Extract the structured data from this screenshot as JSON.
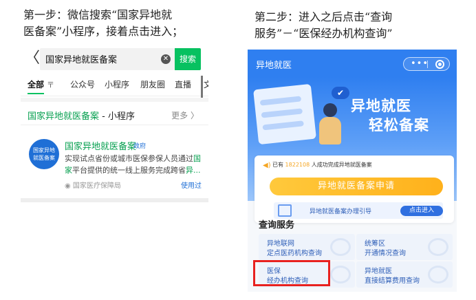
{
  "instructions": {
    "step1": "第一步：微信搜索“国家异地就\n医备案”小程序，接着点击进入；",
    "step2": "第二步：进入之后点击“查询\n服务”－“医保经办机构查询”"
  },
  "wechat_search": {
    "back_glyph": "〈",
    "query": "国家异地就医备案",
    "clear_glyph": "✕",
    "search_button": "搜索",
    "tabs": [
      "全部",
      "公众号",
      "小程序",
      "朋友圈",
      "直播",
      "文"
    ],
    "filter_glyph": "〒",
    "section": {
      "title_green": "国家异地就医备案",
      "title_rest": " - 小程序",
      "more": "更多 〉"
    },
    "result": {
      "logo_text_1": "国家异地",
      "logo_text_2": "就医备案",
      "name": "国家异地就医备案",
      "badge": "政府",
      "desc_1": "实现试点省份或城市医保参保人员通过",
      "desc_g1": "国",
      "desc_g2": "家",
      "desc_2": "平台提供的统一线上服务完成跨省",
      "desc_g3": "异...",
      "provider": "◉ 国家医疗保障局",
      "used": "使用过"
    }
  },
  "miniapp": {
    "nav_title": "异地就医",
    "menu_glyph": "•••",
    "banner": {
      "bubble_glyph": "✔",
      "slogan_1": "异地就医",
      "slogan_2": "轻松备案"
    },
    "card": {
      "sound_glyph": "◀)",
      "count_prefix": "已有 ",
      "count_value": "1822108",
      "count_suffix": " 人成功完成异地就医备案",
      "apply_button": "异地就医备案申请",
      "guide_text": "异地就医备案办理引导",
      "guide_button": "点击进入"
    },
    "services_title": "查询服务",
    "services": [
      {
        "line1": "异地联网",
        "line2": "定点医药机构查询"
      },
      {
        "line1": "统筹区",
        "line2": "开通情况查询"
      },
      {
        "line1": "医保",
        "line2": "经办机构查询"
      },
      {
        "line1": "异地就医",
        "line2": "直接结算费用查询"
      }
    ]
  },
  "colors": {
    "wechat_green": "#07c160",
    "miniapp_blue": "#2f7ff0",
    "highlight_red": "#e8211f",
    "apply_yellow": "#ffb11b"
  }
}
